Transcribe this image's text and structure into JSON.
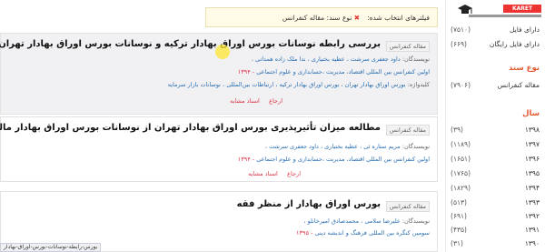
{
  "sidebar": {
    "logo_text": "KARET",
    "file_rows": [
      {
        "label": "دارای فایل",
        "count": "(۷۵۱۰)"
      },
      {
        "label": "دارای فایل رایگان",
        "count": "(۶۶۹)"
      }
    ],
    "doc_type_heading": "نوع سند",
    "doc_types": [
      {
        "label": "مقاله کنفرانس",
        "count": "(۷۹۰۶)"
      }
    ],
    "year_heading": "سال",
    "years": [
      {
        "label": "۱۳۹۸",
        "count": "(۳۹)"
      },
      {
        "label": "۱۳۹۷",
        "count": "(۱۱۸۹)"
      },
      {
        "label": "۱۳۹۶",
        "count": "(۱۶۵۱)"
      },
      {
        "label": "۱۳۹۵",
        "count": "(۱۷۶۵)"
      },
      {
        "label": "۱۳۹۴",
        "count": "(۱۸۲۹)"
      },
      {
        "label": "۱۳۹۳",
        "count": "(۵۱۳)"
      },
      {
        "label": "۱۳۹۲",
        "count": "(۶۹۱)"
      },
      {
        "label": "۱۳۹۱",
        "count": "(۴۳۵)"
      },
      {
        "label": "۱۳۹۰",
        "count": "(۳۱)"
      }
    ]
  },
  "filters": {
    "label": "فیلترهای انتخاب شده:",
    "chip": "نوع سند: مقاله کنفرانس",
    "remove": "✖"
  },
  "results": [
    {
      "type": "مقاله کنفرانس",
      "title": "بررسی رابطه نوسانات بورس اوراق بهادار ترکیه و نوسانات بورس اوراق بهادار تهران",
      "authors_label": "نویسندگان:",
      "authors": "داود جعفری سرشت ، عطیه بختیاری ، ندا ملک زاده همدانی ،",
      "venue": "اولین کنفرانس بین المللی اقتصاد، مدیریت ،حسابداری و علوم اجتماعی",
      "year": "۱۳۹۴",
      "keywords_label": "کلیدواژه:",
      "keywords": "بورس اوراق بهادار تهران ، بورس اوراق بهادار ترکیه ، ارتباطات بین‌المللی ، نوسانات بازار سرمایه",
      "actions": [
        "ارجاع",
        "اسناد مشابه"
      ]
    },
    {
      "type": "مقاله کنفرانس",
      "title": "مطالعه میزان تأثیرپذیری بورس اوراق بهادار تهران از نوسانات بورس اوراق بهادار مالزی",
      "authors_label": "نویسندگان:",
      "authors": "مریم ستاره ئی ، عطیه بختیاری ، داود جعفری سرشت ،",
      "venue": "اولین کنفرانس بین المللی اقتصاد، مدیریت ،حسابداری و علوم اجتماعی",
      "year": "۱۳۹۴",
      "actions": [
        "ارجاع",
        "اسناد مشابه"
      ]
    },
    {
      "type": "مقاله کنفرانس",
      "title": "بورس اوراق بهادار از منظر فقه",
      "authors_label": "نویسندگان:",
      "authors": "علیرضا سلامی ، محمدصادق امیرخانلو ،",
      "venue": "سومین کنگره بین المللی فرهنگ و اندیشه دینی",
      "year": "۱۳۹۵"
    }
  ],
  "status_url": "بورس-رابطه-نوسانات-بورس-اوراق-بهادار"
}
